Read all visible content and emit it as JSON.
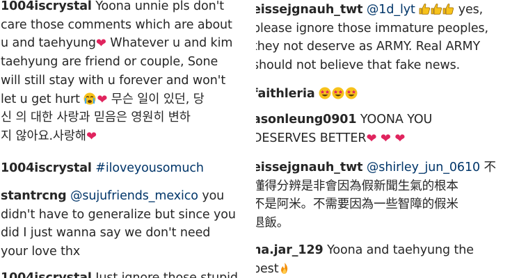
{
  "left_column": {
    "comment_1": {
      "username": "1004iscrystal",
      "lines": [
        "Yoona unnie pls don't",
        "care those comments which are about",
        "u and taehyung",
        " Whatever u and kim",
        "taehyung are friend or couple, Sone",
        "will still stay with u forever and won't",
        "let u get hurt",
        "무슨 일이 있던, 당",
        "신 의 대한 사랑과 믿음은 영원히 변하",
        "지 않아요.사랑해"
      ]
    },
    "comment_2": {
      "username": "1004iscrystal",
      "hashtag": "#iloveyousomuch"
    },
    "comment_3": {
      "username": "stantrcng",
      "mention": "@sujufriends_mexico",
      "lines": [
        " you",
        "didn't have to generalize but since you",
        "did I just wanna say we don't need",
        "your love thx"
      ]
    },
    "comment_4": {
      "username": "1004iscrystal",
      "text": "Just ignore those stupid"
    }
  },
  "right_column": {
    "comment_1": {
      "username": "eissejgnauh_twt",
      "mention": "@1d_lyt",
      "lines": [
        " yes,",
        "please ignore those immature peoples,",
        "they not deserve as ARMY. Real ARMY",
        "should not believe that fake news."
      ]
    },
    "comment_2": {
      "username": "faithleria"
    },
    "comment_3": {
      "username": "asonleung0901",
      "lines": [
        "YOONA YOU",
        "DESERVES BETTER"
      ]
    },
    "comment_4": {
      "username": "eissejgnauh_twt",
      "mention": "@shirley_jun_0610",
      "lines": [
        " 不",
        "懂得分辨是非會因為假新聞生氣的根本",
        "不是阿米。不需要因為一些智障的假米",
        "退飯。"
      ]
    },
    "comment_5": {
      "username": "na.jar_129",
      "lines": [
        "Yoona and taehyung the",
        "best"
      ]
    }
  },
  "icons": {
    "heart": "red-heart-icon",
    "crying": "crying-face-icon",
    "sparkling_heart": "sparkling-heart-icon",
    "thumbs": "thumbs-up-icon",
    "star_eyes": "star-struck-face-icon",
    "fire": "fire-icon"
  },
  "colors": {
    "text": "#262626",
    "mention": "#003569",
    "heart": "#e0245e",
    "emoji_yellow": "#f7c21b"
  }
}
